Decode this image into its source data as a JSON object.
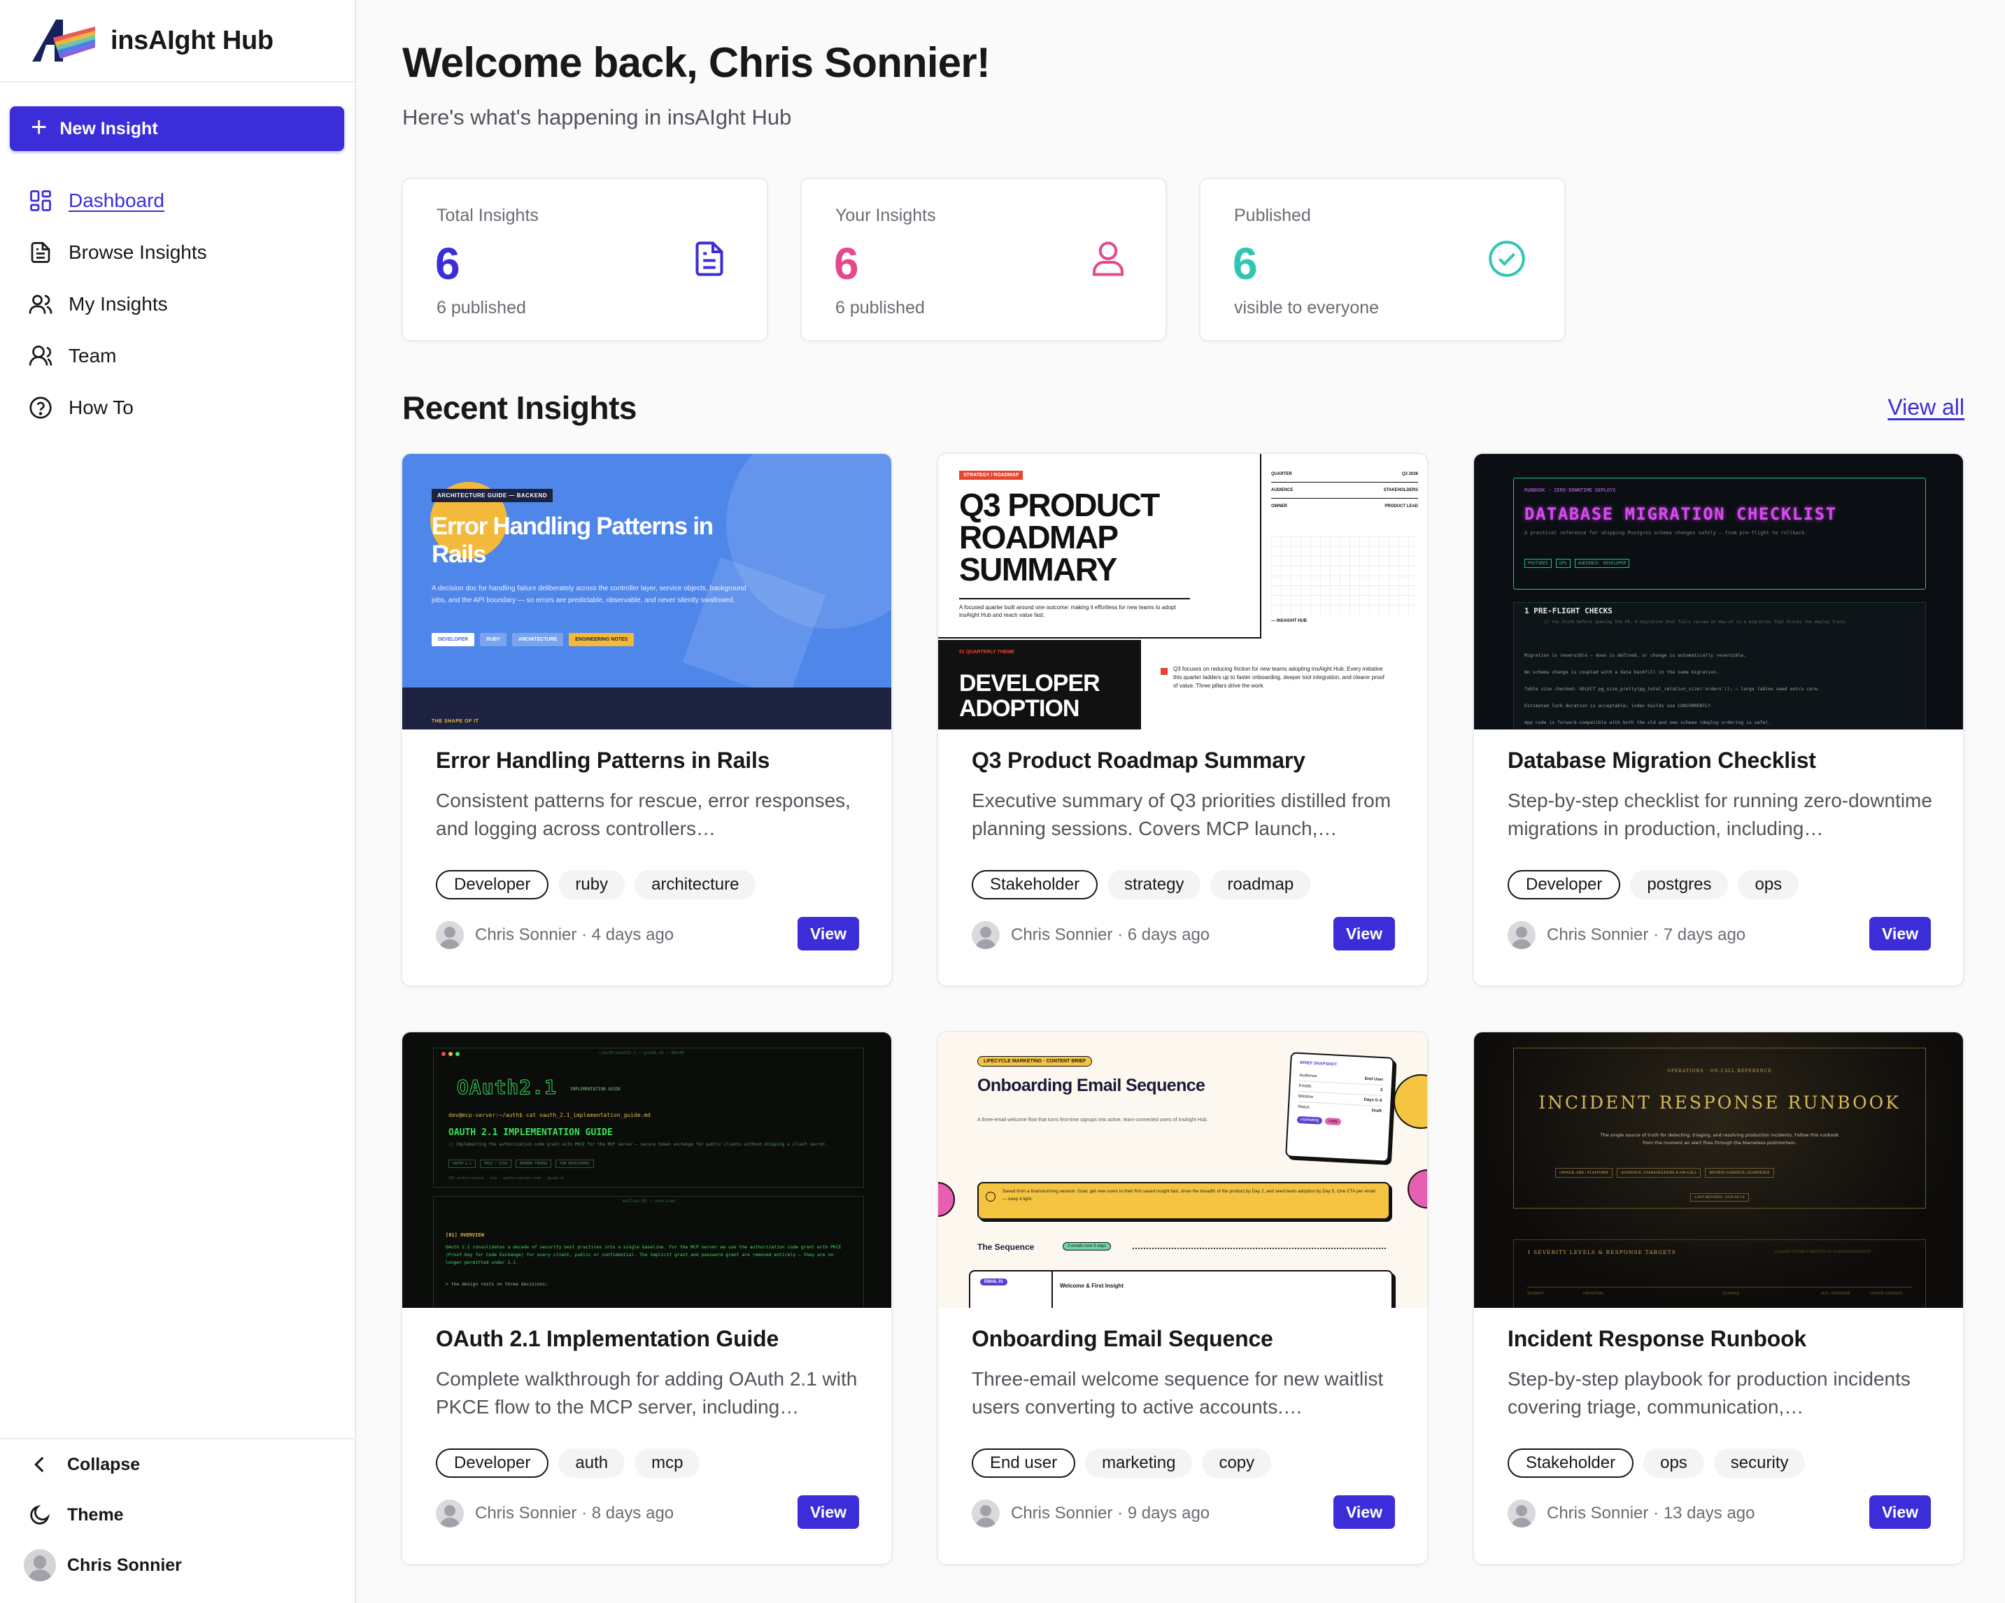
{
  "app": {
    "name": "insAIght Hub"
  },
  "sidebar": {
    "new_button": "New Insight",
    "nav": [
      {
        "label": "Dashboard",
        "icon": "dashboard-grid-icon",
        "active": true
      },
      {
        "label": "Browse Insights",
        "icon": "document-icon"
      },
      {
        "label": "My Insights",
        "icon": "users-icon"
      },
      {
        "label": "Team",
        "icon": "team-icon"
      },
      {
        "label": "How To",
        "icon": "help-circle-icon"
      }
    ],
    "bottom": {
      "collapse": "Collapse",
      "theme": "Theme",
      "user": "Chris Sonnier"
    }
  },
  "header": {
    "welcome": "Welcome back, Chris Sonnier!",
    "subtitle": "Here's what's happening in insAIght Hub"
  },
  "stats": [
    {
      "label": "Total Insights",
      "value": "6",
      "note": "6 published",
      "color": "#3b2ed8",
      "icon": "file-icon"
    },
    {
      "label": "Your Insights",
      "value": "6",
      "note": "6 published",
      "color": "#e6488c",
      "icon": "user-icon"
    },
    {
      "label": "Published",
      "value": "6",
      "note": "visible to everyone",
      "color": "#2fc6b2",
      "icon": "check-circle-icon"
    }
  ],
  "recent": {
    "title": "Recent Insights",
    "view_all": "View all",
    "view_label": "View",
    "cards": [
      {
        "title": "Error Handling Patterns in Rails",
        "desc": "Consistent patterns for rescue, error responses, and logging across controllers…",
        "tags": [
          "Developer",
          "ruby",
          "architecture"
        ],
        "meta": "Chris Sonnier · 4 days ago",
        "thumb": {
          "eyebrow": "ARCHITECTURE GUIDE — BACKEND",
          "title": "Error Handling Patterns in Rails",
          "text": "A decision doc for handling failure deliberately across the controller layer, service objects, background jobs, and the API boundary — so errors are predictable, observable, and never silently swallowed.",
          "pills": [
            "DEVELOPER",
            "RUBY",
            "ARCHITECTURE",
            "ENGINEERING NOTES"
          ],
          "footer": "THE SHAPE OF IT"
        }
      },
      {
        "title": "Q3 Product Roadmap Summary",
        "desc": "Executive summary of Q3 priorities distilled from planning sessions. Covers MCP launch,…",
        "tags": [
          "Stakeholder",
          "strategy",
          "roadmap"
        ],
        "meta": "Chris Sonnier · 6 days ago",
        "thumb": {
          "eyebrow": "STRATEGY / ROADMAP",
          "title": "Q3 PRODUCT ROADMAP SUMMARY",
          "text": "A focused quarter built around one outcome: making it effortless for new teams to adopt insAIght Hub and reach value fast.",
          "table": [
            [
              "QUARTER",
              "Q3 2026"
            ],
            [
              "AUDIENCE",
              "STAKEHOLDERS"
            ],
            [
              "OWNER",
              "PRODUCT LEAD"
            ]
          ],
          "side_foot": "— INSAIGHT HUB",
          "theme_label": "01 QUARTERLY THEME",
          "theme_title": "DEVELOPER ADOPTION",
          "theme_text": "Q3 focuses on reducing friction for new teams adopting insAIght Hub. Every initiative this quarter ladders up to faster onboarding, deeper tool integration, and clearer proof of value. Three pillars drive the work."
        }
      },
      {
        "title": "Database Migration Checklist",
        "desc": "Step-by-step checklist for running zero-downtime migrations in production, including…",
        "tags": [
          "Developer",
          "postgres",
          "ops"
        ],
        "meta": "Chris Sonnier · 7 days ago",
        "thumb": {
          "eyebrow": "RUNBOOK · ZERO-DOWNTIME DEPLOYS",
          "title": "DATABASE MIGRATION CHECKLIST",
          "text": "A practical reference for shipping Postgres schema changes safely — from pre-flight to rollback.",
          "pills": [
            "POSTGRES",
            "OPS",
            "AUDIENCE: DEVELOPER"
          ],
          "section": "1 PRE-FLIGHT CHECKS",
          "section_text": "// You think before opening the PR. A migration that fails review on day-of is a migration that blocks the deploy train.",
          "checks": [
            "Migration is reversible — down is defined, or change is automatically reversible.",
            "No schema change is coupled with a data backfill in the same migration.",
            "Table size checked: SELECT pg_size_pretty(pg_total_relation_size('orders')); — large tables need extra care.",
            "Estimated lock duration is acceptable; index builds use CONCURRENTLY.",
            "App code is forward-compatible with both the old and new schema (deploy ordering is safe)."
          ]
        }
      },
      {
        "title": "OAuth 2.1 Implementation Guide",
        "desc": "Complete walkthrough for adding OAuth 2.1 with PKCE flow to the MCP server, including…",
        "tags": [
          "Developer",
          "auth",
          "mcp"
        ],
        "meta": "Chris Sonnier · 8 days ago",
        "thumb": {
          "path": "~/auth/oauth2.1 — guide.sh — 80×40",
          "title": "OAuth2.1",
          "subtitle": "IMPLEMENTATION GUIDE",
          "cmd": "dev@mcp-server:~/auth$ cat oauth_2.1_implementation_guide.md",
          "heading": "OAUTH 2.1 IMPLEMENTATION GUIDE",
          "text": "// Implementing the authorization code grant with PKCE for the MCP server — secure token exchange for public clients without shipping a client secret.",
          "pills": [
            "OAUTH 2.1",
            "PKCE / S256",
            "BEARER TOKENS",
            "FOR DEVELOPERS"
          ],
          "status": "SEC  authorization · mcp · authorization.code · guide.sh",
          "panel_title": "section.01 — overview",
          "overview": "[01] OVERVIEW",
          "overview_text": "OAuth 2.1 consolidates a decade of security best practices into a single baseline. For the MCP server we use the authorization code grant with PKCE (Proof Key for Code Exchange) for every client, public or confidential. The implicit grant and password grant are removed entirely — they are no longer permitted under 2.1.",
          "prompt": "> the design rests on three decisions:"
        }
      },
      {
        "title": "Onboarding Email Sequence",
        "desc": "Three-email welcome sequence for new waitlist users converting to active accounts.…",
        "tags": [
          "End user",
          "marketing",
          "copy"
        ],
        "meta": "Chris Sonnier · 9 days ago",
        "thumb": {
          "eyebrow": "LIFECYCLE MARKETING · CONTENT BRIEF",
          "title": "Onboarding Email Sequence",
          "text": "A three-email welcome flow that turns first-time signups into active, team-connected users of insAIght Hub.",
          "brief_title": "BRIEF SNAPSHOT",
          "brief": [
            [
              "Audience",
              "End User"
            ],
            [
              "Emails",
              "3"
            ],
            [
              "Window",
              "Days 0–5"
            ],
            [
              "Status",
              "Draft"
            ]
          ],
          "brief_pills": [
            "marketing",
            "copy"
          ],
          "callout": "Saved from a brainstorming session. Goal: get new users to their first saved insight fast, show the breadth of the product by Day 2, and seed team adoption by Day 5. One CTA per email — keep it light.",
          "seq_label": "The Sequence",
          "seq_pill": "3 emails over 5 days",
          "email_pill": "EMAIL 01",
          "email_title": "Welcome & First Insight"
        }
      },
      {
        "title": "Incident Response Runbook",
        "desc": "Step-by-step playbook for production incidents covering triage, communication,…",
        "tags": [
          "Stakeholder",
          "ops",
          "security"
        ],
        "meta": "Chris Sonnier · 13 days ago",
        "thumb": {
          "eyebrow": "OPERATIONS · ON-CALL REFERENCE",
          "title": "INCIDENT RESPONSE RUNBOOK",
          "text": "The single source of truth for detecting, triaging, and resolving production incidents. Follow this runbook from the moment an alert fires through the blameless postmortem.",
          "pills": [
            "OWNER: SRE / PLATFORM",
            "AUDIENCE: STAKEHOLDERS & ON-CALL",
            "REVIEW CADENCE: QUARTERLY"
          ],
          "revised": "LAST REVISED: 2026-05-14",
          "section": "1  SEVERITY LEVELS & RESPONSE TARGETS",
          "section_note": "CLASSIFY WITHIN 5 MINUTES OF ACKNOWLEDGEMENT",
          "cols": [
            "SEVERITY",
            "DEFINITION",
            "EXAMPLE",
            "ACK / RESPONSE",
            "UPDATE CADENCE"
          ]
        }
      }
    ]
  }
}
